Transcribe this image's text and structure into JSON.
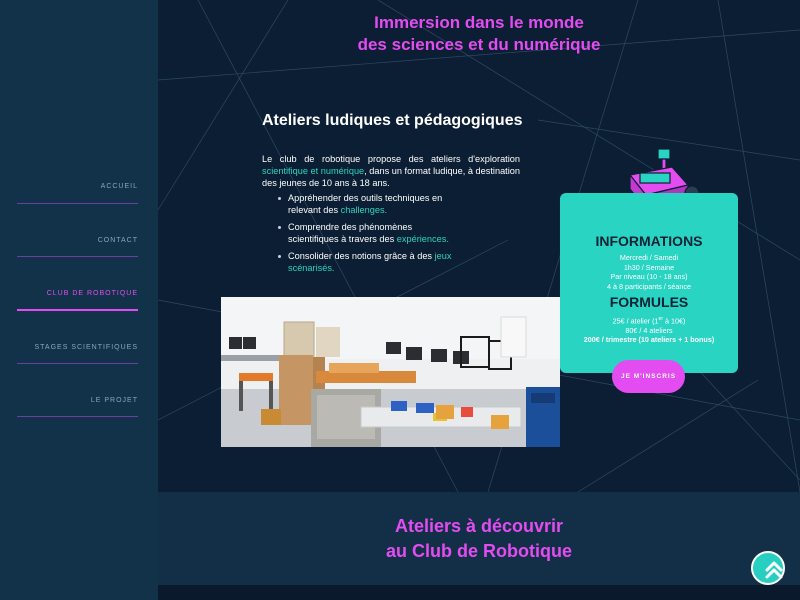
{
  "nav": {
    "items": [
      {
        "label": "ACCUEIL",
        "active": false
      },
      {
        "label": "CONTACT",
        "active": false
      },
      {
        "label": "CLUB DE ROBOTIQUE",
        "active": true
      },
      {
        "label": "STAGES SCIENTIFIQUES",
        "active": false
      },
      {
        "label": "LE PROJET",
        "active": false
      }
    ]
  },
  "hero": {
    "line1": "Immersion dans le monde",
    "line2": "des sciences et du numérique"
  },
  "workshops": {
    "title": "Ateliers ludiques et pédagogiques",
    "intro_a": "Le club de robotique propose des ateliers d'exploration ",
    "intro_accent": "scientifique et numérique",
    "intro_b": ", dans un format ludique, à destination des jeunes de 10 ans à 18 ans.",
    "bullets": [
      {
        "text": "Appréhender des outils techniques en relevant des ",
        "accent": "challenges."
      },
      {
        "text": "Comprendre des phénomènes scientifiques à travers des ",
        "accent": "expériences."
      },
      {
        "text": "Consolider des notions grâce à des ",
        "accent": "jeux scénarisés."
      }
    ]
  },
  "info": {
    "title": "INFORMATIONS",
    "lines": [
      "Mercredi / Samedi",
      "1h30 / Semaine",
      "Par niveau (10 - 18 ans)",
      "4 à 8 participants / séance"
    ],
    "formules_title": "FORMULES",
    "formule_1_a": "25€ / atelier (1",
    "formule_1_sup": "er",
    "formule_1_b": " à 10€)",
    "formule_2": "80€ / 4 ateliers",
    "formule_3": "200€ / trimestre (10 ateliers + 1 bonus)",
    "cta_label": "JE M'INSCRIS"
  },
  "band": {
    "line1": "Ateliers à découvrir",
    "line2": "au Club de Robotique"
  },
  "colors": {
    "accent_pink": "#e34cf0",
    "accent_teal": "#2ad4c2",
    "background": "#0c1e33"
  },
  "icons": [
    "robot-icon",
    "double-chevron-up-icon"
  ]
}
